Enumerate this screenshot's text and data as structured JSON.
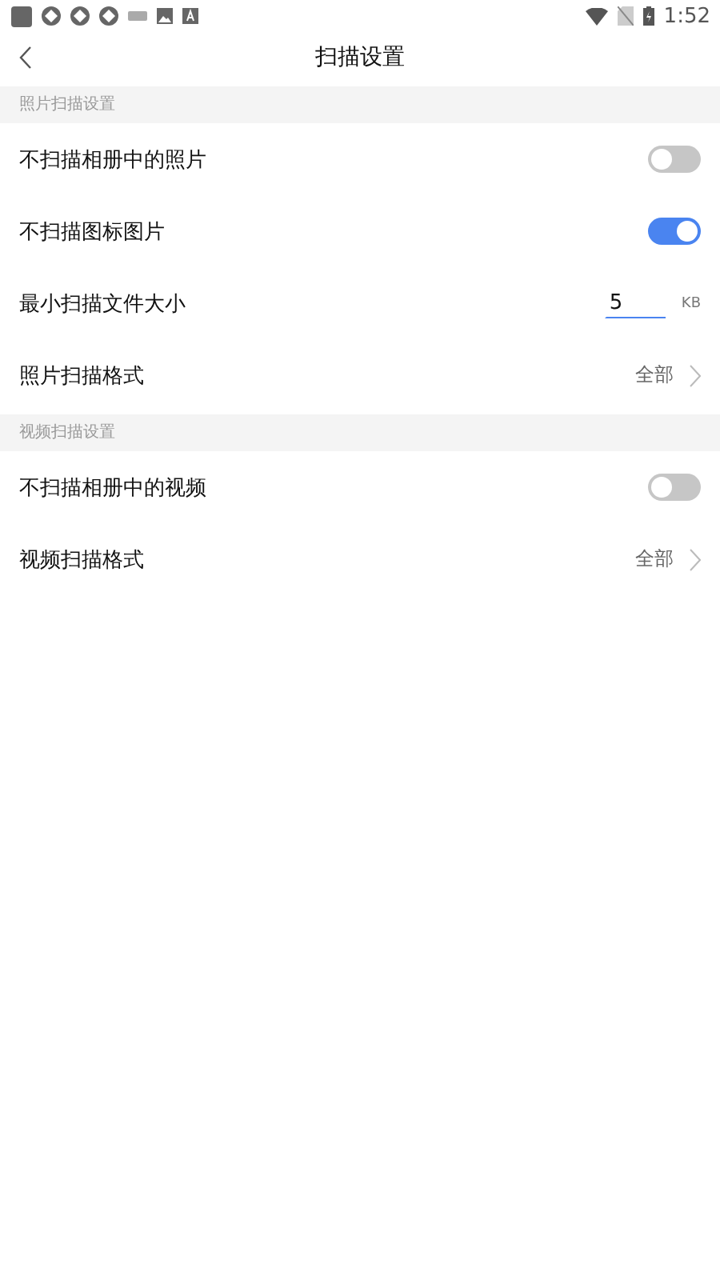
{
  "status_bar": {
    "time": "1:52"
  },
  "header": {
    "title": "扫描设置"
  },
  "sections": [
    {
      "title": "照片扫描设置",
      "items": [
        {
          "kind": "toggle",
          "label": "不扫描相册中的照片",
          "on": false
        },
        {
          "kind": "toggle",
          "label": "不扫描图标图片",
          "on": true
        },
        {
          "kind": "number",
          "label": "最小扫描文件大小",
          "value": "5",
          "unit": "KB"
        },
        {
          "kind": "select",
          "label": "照片扫描格式",
          "value": "全部"
        }
      ]
    },
    {
      "title": "视频扫描设置",
      "items": [
        {
          "kind": "toggle",
          "label": "不扫描相册中的视频",
          "on": false
        },
        {
          "kind": "select",
          "label": "视频扫描格式",
          "value": "全部"
        }
      ]
    }
  ]
}
